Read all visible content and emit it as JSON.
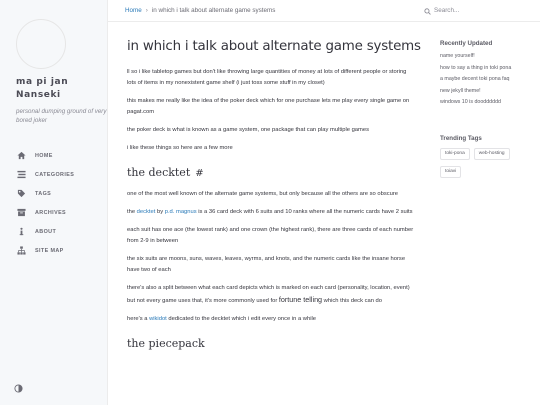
{
  "sidebar": {
    "title": "ma pi jan Nanseki",
    "subtitle": "personal dumping ground of very bored joker",
    "nav": [
      {
        "label": "HOME",
        "icon": "home-icon"
      },
      {
        "label": "CATEGORIES",
        "icon": "stream-icon"
      },
      {
        "label": "TAGS",
        "icon": "tag-icon"
      },
      {
        "label": "ARCHIVES",
        "icon": "archive-icon"
      },
      {
        "label": "ABOUT",
        "icon": "info-icon"
      },
      {
        "label": "SITE MAP",
        "icon": "sitemap-icon"
      }
    ],
    "theme_icon": "theme-toggle-icon"
  },
  "topbar": {
    "breadcrumb_home": "Home",
    "breadcrumb_sep": "›",
    "breadcrumb_current": "in which i talk about alternate game systems",
    "search_placeholder": "Search..."
  },
  "post": {
    "title": "in which i talk about alternate game systems",
    "p1": "ll so i like tabletop games but don't like throwing large quantities of money at lots of different people or storing lots of items in my nonexistent game shelf (i just toss some stuff in my closet)",
    "p2": "this makes me really like the idea of the poker deck which for one purchase lets me play every single game on pagat.com",
    "p3": "the poker deck is what is known as a game system, one package that can play multiple games",
    "p4": "i like these things so here are a few more",
    "h_decktet": "the decktet",
    "h_hash": "#",
    "p5": "one of the most well known of the alternate game systems, but only because all the others are so obscure",
    "p6_pre": "the ",
    "p6_link1": "decktet",
    "p6_mid": " by ",
    "p6_link2": "p.d. magnus",
    "p6_post": " is a 36 card deck with 6 suits and 10 ranks where all the numeric cards have 2 suits",
    "p7": "each suit has one ace (the lowest rank) and one crown (the highest rank), there are three cards of each number from 2-9 in between",
    "p8": "the six suits are moons, suns, waves, leaves, wyrms, and knots, and the numeric cards like the insane horse have two of each",
    "p9_pre": "there's also a split between what each card depicts which is marked on each card (personality, location, event) but not every game uses that, it's more commonly used for ",
    "p9_big": "fortune telling",
    "p9_post": " which this deck can do",
    "p10_pre": "here's a ",
    "p10_link": "wikidot",
    "p10_post": " dedicated to the decktet which i edit every once in a while",
    "h_next": "the piecepack"
  },
  "panel": {
    "recent_title": "Recently Updated",
    "recent": [
      "name yourself!",
      "how to say a thing in toki pona",
      "a maybe decent toki pona faq",
      "new jekyll theme!",
      "windows 10 is doodddddd"
    ],
    "tags_title": "Trending Tags",
    "tags": [
      "toki-pona",
      "web-hosting",
      "toiavi"
    ]
  },
  "colors": {
    "link": "#2a7ab8",
    "sidebar_bg": "#f6f8fa",
    "text": "#34343c"
  }
}
